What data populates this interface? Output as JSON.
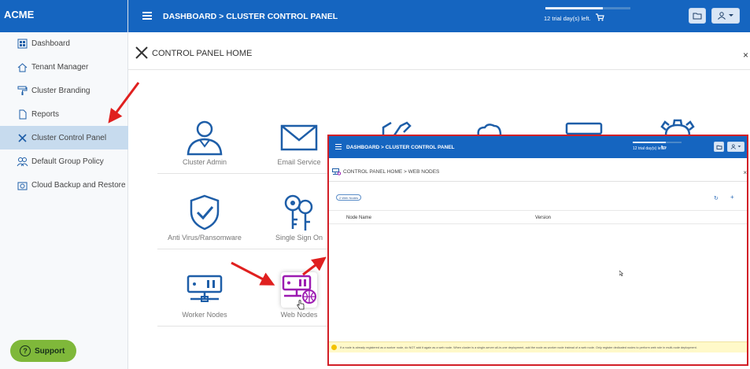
{
  "app": {
    "brand": "ACME"
  },
  "sidebar": {
    "items": [
      {
        "label": "Dashboard",
        "icon": "dashboard-icon"
      },
      {
        "label": "Tenant Manager",
        "icon": "home-icon"
      },
      {
        "label": "Cluster Branding",
        "icon": "paint-roller-icon"
      },
      {
        "label": "Reports",
        "icon": "document-icon"
      },
      {
        "label": "Cluster Control Panel",
        "icon": "tools-icon",
        "active": true
      },
      {
        "label": "Default Group Policy",
        "icon": "users-icon"
      },
      {
        "label": "Cloud Backup and Restore",
        "icon": "camera-icon"
      }
    ],
    "support_label": "Support",
    "support_icon": "?"
  },
  "header": {
    "breadcrumb": "DASHBOARD > CLUSTER CONTROL PANEL",
    "trial_text": "12 trial day(s) left.",
    "trial_progress": 0.68,
    "cart_icon": "🛒"
  },
  "control_panel": {
    "title": "CONTROL PANEL HOME",
    "close": "×",
    "tiles": [
      {
        "label": "Cluster Admin",
        "icon": "user-icon"
      },
      {
        "label": "Email Service",
        "icon": "envelope-icon"
      },
      {
        "label": "Anti Virus/Ransomware",
        "icon": "shield-check-icon"
      },
      {
        "label": "Single Sign On",
        "icon": "keys-icon"
      },
      {
        "label": "Worker Nodes",
        "icon": "server-network-icon"
      },
      {
        "label": "Web Nodes",
        "icon": "server-globe-icon"
      }
    ]
  },
  "inset": {
    "breadcrumb": "DASHBOARD > CLUSTER CONTROL PANEL",
    "trial_text": "12 trial day(s) left.",
    "page_breadcrumb": "CONTROL PANEL HOME  >  WEB NODES",
    "close": "×",
    "pill": "2 Web Nodes",
    "refresh": "↻",
    "add": "+",
    "columns": [
      "Node Name",
      "Version"
    ],
    "warning": "If a node is already registered as a worker node, do NOT add it again as a web node. When cluster is a single-server all-in-one deployment, add the node as worker node instead of a web node. Only register dedicated nodes to perform web role in multi-node deployment."
  },
  "colors": {
    "primary": "#1565c0",
    "accent_web": "#9c1ab1",
    "annotation": "#d21f27",
    "support": "#7fb83a"
  }
}
